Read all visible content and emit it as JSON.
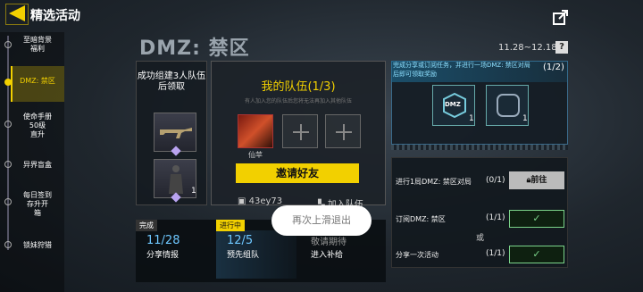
{
  "header": {
    "title": "精选活动"
  },
  "sidebar": {
    "items": [
      {
        "label": "至暗背景\n福利"
      },
      {
        "label": "DMZ: 禁区"
      },
      {
        "label": "使命手册\n50级\n直升"
      },
      {
        "label": "异界盲盒"
      },
      {
        "label": "每日签到\n存升开\n箱"
      },
      {
        "label": "锁妹狩猎"
      }
    ]
  },
  "event": {
    "title": "DMZ: 禁区",
    "date_range": "11.28~12.18",
    "help": "?"
  },
  "reward": {
    "title": "成功组建3人队伍后领取",
    "items": [
      {
        "qty": ""
      },
      {
        "qty": "1"
      }
    ]
  },
  "team": {
    "title": "我的队伍(1/3)",
    "hint": "有人加入您的队伍后您将无法再加入其他队伍",
    "member_name": "仙苹",
    "invite_label": "邀请好友",
    "code": "43ey73",
    "join_label": "加入队伍"
  },
  "right_panel": {
    "desc": "完成分享或订阅任务，并进行一场DMZ: 禁区对局后即可领取奖励",
    "count": "(1/2)",
    "cards": [
      {
        "label": "DMZ",
        "qty": "1"
      },
      {
        "label": "",
        "qty": "1"
      }
    ],
    "tasks": [
      {
        "name": "进行1局DMZ: 禁区对局",
        "count": "(0/1)",
        "action": "前往"
      },
      {
        "name": "订阅DMZ: 禁区",
        "count": "(1/1)",
        "action": "✓"
      },
      {
        "name": "分享一次活动",
        "count": "(1/1)",
        "action": "✓"
      }
    ],
    "or_label": "或"
  },
  "stages": [
    {
      "status": "完成",
      "num": "11/28",
      "name": "分享情报"
    },
    {
      "status": "进行中",
      "num": "12/5",
      "name": "预先组队"
    },
    {
      "status": "",
      "num": "敬请期待",
      "name": "进入补给"
    }
  ],
  "toast": {
    "text": "再次上滑退出"
  }
}
